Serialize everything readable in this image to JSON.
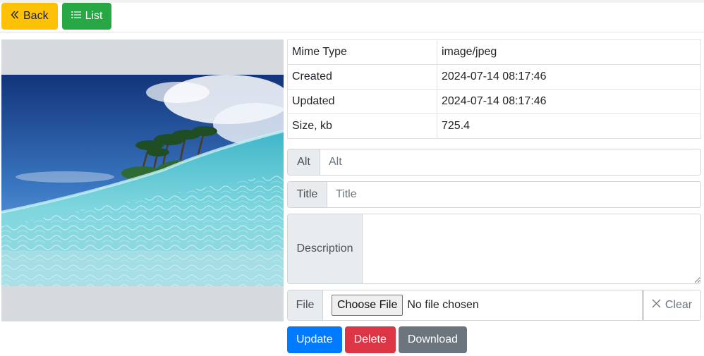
{
  "toolbar": {
    "back_label": "Back",
    "back_icon": "double-chevron-left-icon",
    "list_label": "List",
    "list_icon": "list-icon"
  },
  "meta": {
    "rows": [
      {
        "label": "Mime Type",
        "value": "image/jpeg"
      },
      {
        "label": "Created",
        "value": "2024-07-14 08:17:46"
      },
      {
        "label": "Updated",
        "value": "2024-07-14 08:17:46"
      },
      {
        "label": "Size, kb",
        "value": "725.4"
      }
    ]
  },
  "form": {
    "alt_label": "Alt",
    "alt_placeholder": "Alt",
    "alt_value": "",
    "title_label": "Title",
    "title_placeholder": "Title",
    "title_value": "",
    "description_label": "Description",
    "description_value": "",
    "file_label": "File",
    "choose_file_label": "Choose File",
    "no_file_text": "No file chosen",
    "clear_label": "Clear",
    "clear_icon": "close-icon"
  },
  "actions": {
    "update_label": "Update",
    "delete_label": "Delete",
    "download_label": "Download"
  },
  "colors": {
    "warning": "#ffc107",
    "success": "#28a745",
    "primary": "#007bff",
    "danger": "#dc3545",
    "secondary": "#6c757d"
  }
}
